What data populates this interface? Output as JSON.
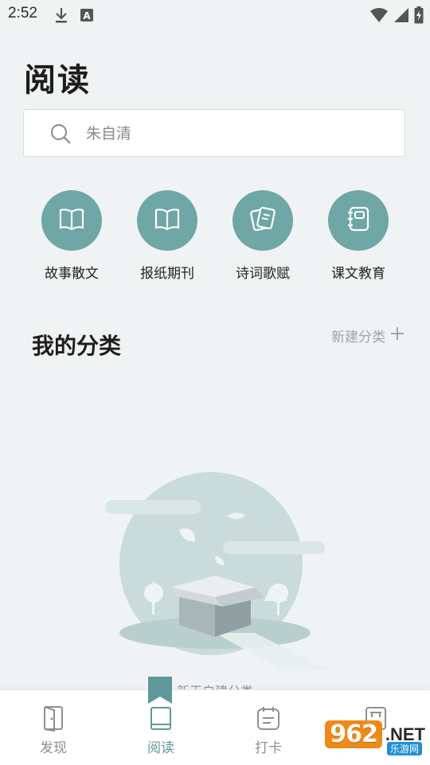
{
  "status_bar": {
    "time": "2:52",
    "left_icons": [
      "download-icon",
      "keyboard-a-icon"
    ],
    "right_icons": [
      "wifi-icon",
      "signal-icon",
      "battery-charging-icon"
    ]
  },
  "page": {
    "title": "阅读"
  },
  "search": {
    "placeholder": "朱自清",
    "icon": "search-icon"
  },
  "categories": [
    {
      "label": "故事散文",
      "icon": "open-book-icon"
    },
    {
      "label": "报纸期刊",
      "icon": "open-book-icon"
    },
    {
      "label": "诗词歌赋",
      "icon": "poetry-cards-icon"
    },
    {
      "label": "课文教育",
      "icon": "notebook-icon"
    }
  ],
  "my_categories": {
    "title": "我的分类",
    "new_button_label": "新建分类",
    "new_button_icon": "plus-icon",
    "empty_hint": "新无自建分类"
  },
  "bottom_nav": {
    "items": [
      {
        "label": "发现",
        "icon": "door-icon",
        "active": false
      },
      {
        "label": "阅读",
        "icon": "book-icon",
        "active": true
      },
      {
        "label": "打卡",
        "icon": "calendar-icon",
        "active": false
      },
      {
        "label": "",
        "icon": "profile-card-icon",
        "active": false
      }
    ]
  },
  "watermark": {
    "brand": "962",
    "suffix": ".NET",
    "sub": "乐游网"
  },
  "colors": {
    "accent": "#6fa6a6",
    "active_nav": "#5f9999",
    "background": "#f0f3f4"
  }
}
